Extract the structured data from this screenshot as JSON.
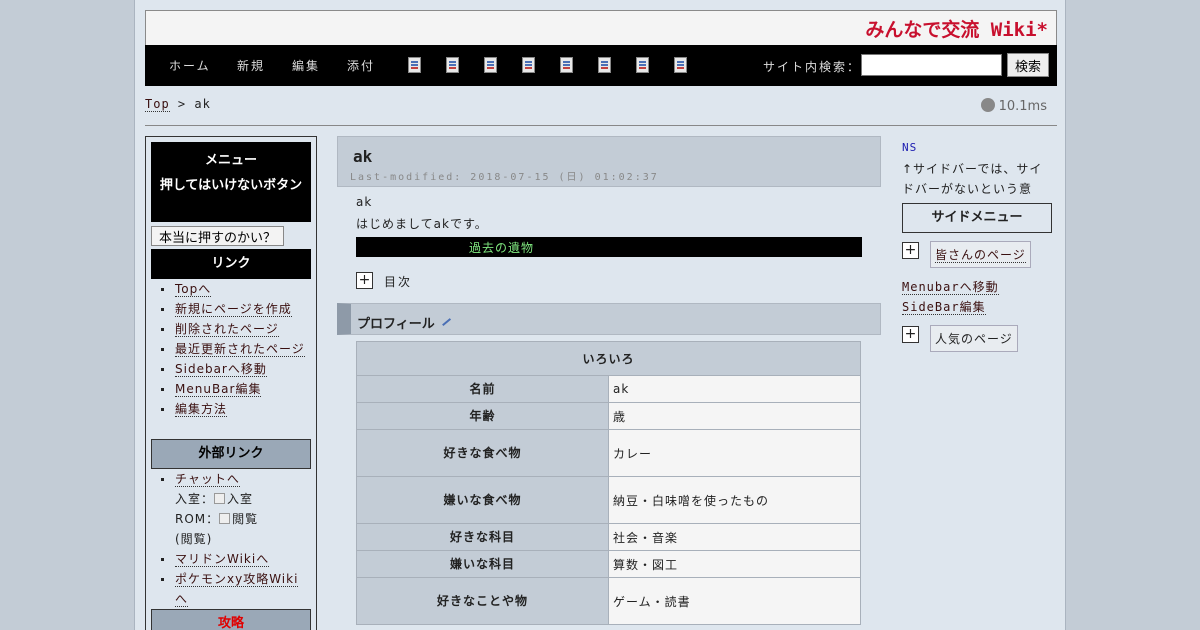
{
  "site_title": "みんなで交流 Wiki*",
  "nav": {
    "items": [
      "ホーム",
      "新規",
      "編集",
      "添付"
    ],
    "tool_icons": [
      "new-page-icon",
      "reload-icon",
      "diff-icon",
      "backup-icon",
      "attach-icon",
      "copy-icon",
      "list-icon",
      "help-icon"
    ],
    "search_label": "サイト内検索：",
    "search_value": "",
    "search_button": "検索"
  },
  "breadcrumb": {
    "top": "Top",
    "sep": " > ",
    "current": "ak"
  },
  "timing": "10.1ms",
  "menubar": {
    "menu_title": "メニュー",
    "danger_title": "押してはいけないボタン",
    "danger_button": "本当に押すのかい？",
    "links_title": "リンク",
    "links": [
      "Topへ",
      "新規にページを作成",
      "削除されたページ",
      "最近更新されたページ",
      "Sidebarへ移動",
      "MenuBar編集",
      "編集方法"
    ],
    "external_title": "外部リンク",
    "chat": "チャットへ",
    "chat_enter": "入室：",
    "chat_enter_alt": "入室",
    "chat_rom": "ROM：",
    "chat_rom_alt": "閲覧",
    "chat_rom_note": "(閲覧)",
    "external_links": [
      "マリドンWikiへ",
      "ポケモンxy攻略Wikiへ"
    ],
    "strategy_title": "攻略"
  },
  "content": {
    "title": "ak",
    "last_modified": "Last-modified: 2018-07-15 (日) 01:02:37",
    "line1": "ak",
    "line2": "はじめましてakです。",
    "legacy": "過去の遺物",
    "toc_toggle": "+",
    "toc_label": "目次",
    "section_title": "プロフィール",
    "table_caption": "いろいろ",
    "rows": [
      {
        "k": "名前",
        "v": "ak"
      },
      {
        "k": "年齢",
        "v": "歳"
      },
      {
        "k": "好きな食べ物",
        "v": "カレー"
      },
      {
        "k": "嫌いな食べ物",
        "v": "納豆・白味噌を使ったもの"
      },
      {
        "k": "好きな科目",
        "v": "社会・音楽"
      },
      {
        "k": "嫌いな科目",
        "v": "算数・図工"
      },
      {
        "k": "好きなことや物",
        "v": "ゲーム・読書"
      }
    ]
  },
  "sidebar": {
    "ns": "NS",
    "note": "↑サイドバーでは、サイドバーがないという意",
    "menu_title": "サイドメニュー",
    "toggle": "+",
    "box1": "皆さんのページ",
    "link1": "Menubarへ移動",
    "link2": "SideBar編集",
    "box2": "人気のページ"
  }
}
